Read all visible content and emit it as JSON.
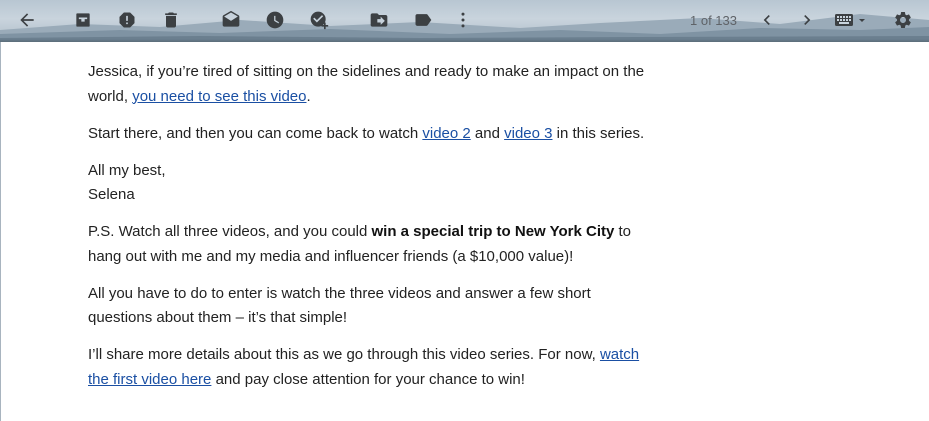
{
  "toolbar": {
    "icons": [
      {
        "name": "back-arrow-icon",
        "title": "Back to Inbox"
      },
      {
        "name": "archive-icon",
        "title": "Archive"
      },
      {
        "name": "report-spam-icon",
        "title": "Report spam"
      },
      {
        "name": "delete-icon",
        "title": "Delete"
      },
      {
        "name": "mark-unread-icon",
        "title": "Mark as unread"
      },
      {
        "name": "snooze-icon",
        "title": "Snooze"
      },
      {
        "name": "add-to-tasks-icon",
        "title": "Add to Tasks"
      },
      {
        "name": "move-to-icon",
        "title": "Move to"
      },
      {
        "name": "labels-icon",
        "title": "Labels"
      },
      {
        "name": "more-vert-icon",
        "title": "More"
      },
      {
        "name": "newer-chevron-icon",
        "title": "Newer"
      },
      {
        "name": "older-chevron-icon",
        "title": "Older"
      },
      {
        "name": "keyboard-icon",
        "title": "Input tools"
      },
      {
        "name": "settings-gear-icon",
        "title": "Settings"
      }
    ],
    "pager_text": "1 of 133",
    "icon_color": "#3c4043"
  },
  "email": {
    "para1_text1": "Jessica, if you’re tired of sitting on the sidelines and ready to make an impact on the world, ",
    "para1_link": "you need to see this video",
    "para1_text2": ".",
    "para2_text1": "Start there, and then you can come back to watch ",
    "para2_link1": "video 2",
    "para2_text2": " and ",
    "para2_link2": "video 3",
    "para2_text3": " in this series.",
    "signoff": "All my best,",
    "signature": "Selena",
    "ps_text1": "P.S. Watch all three videos, and you could ",
    "ps_bold": "win a special trip to New York City",
    "ps_text2": " to hang out with me and my media and influencer friends (a $10,000 value)!",
    "para4": "All you have to do to enter is watch the three videos and answer a few short questions about them – it’s that simple!",
    "para5_text1": "I’ll share more details about this as we go through this video series. For now, ",
    "para5_link": "watch the first video here",
    "para5_text2": " and pay close attention for your chance to win!",
    "link_color": "#1a4fa3"
  }
}
